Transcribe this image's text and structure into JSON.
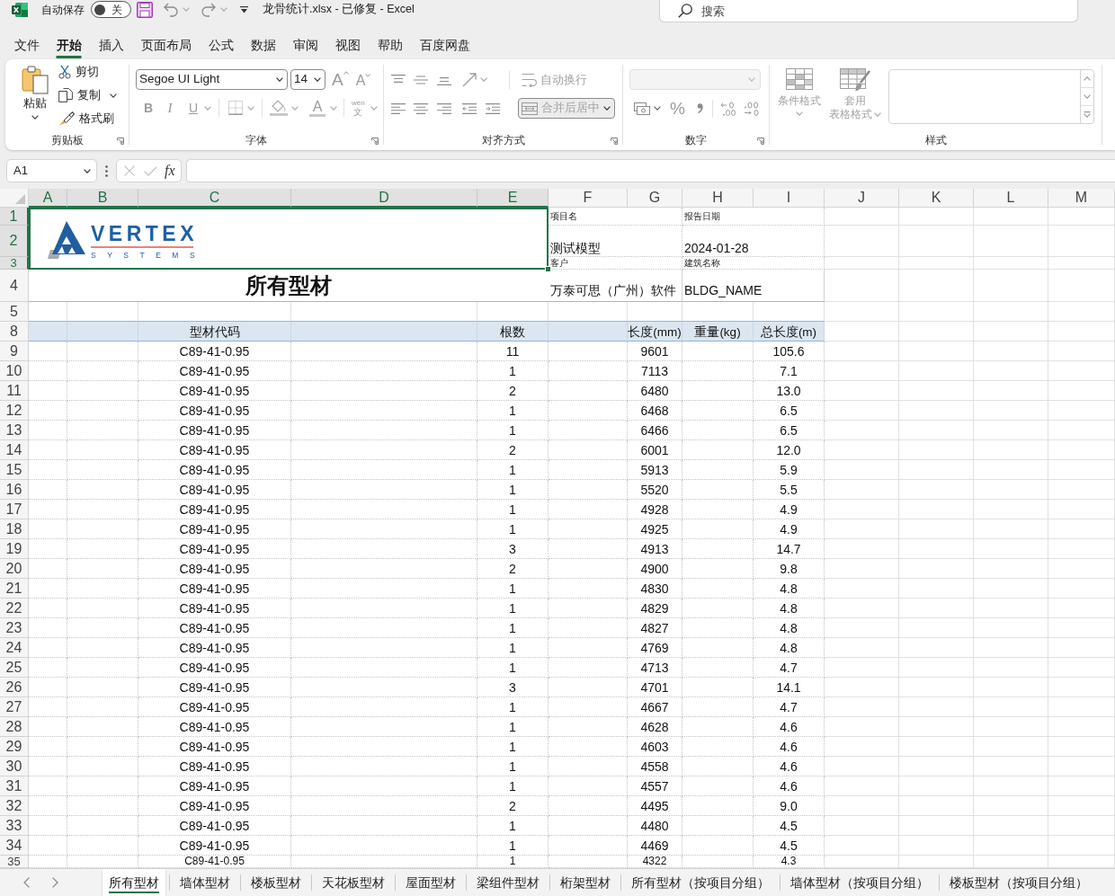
{
  "title_bar": {
    "autosave_label": "自动保存",
    "autosave": {
      "on": false,
      "label": "关"
    },
    "title": "龙骨统计.xlsx - 已修复 - Excel",
    "search": {
      "placeholder": "搜索"
    }
  },
  "ribbon_tabs": [
    {
      "label": "文件",
      "selected": false
    },
    {
      "label": "开始",
      "selected": true
    },
    {
      "label": "插入",
      "selected": false
    },
    {
      "label": "页面布局",
      "selected": false
    },
    {
      "label": "公式",
      "selected": false
    },
    {
      "label": "数据",
      "selected": false
    },
    {
      "label": "审阅",
      "selected": false
    },
    {
      "label": "视图",
      "selected": false
    },
    {
      "label": "帮助",
      "selected": false
    },
    {
      "label": "百度网盘",
      "selected": false
    }
  ],
  "ribbon": {
    "clipboard": {
      "label": "剪贴板",
      "paste": "粘贴",
      "cut": "剪切",
      "copy": "复制",
      "format_painter": "格式刷"
    },
    "font": {
      "label": "字体",
      "font_name": "Segoe UI Light",
      "font_size": "14",
      "grow": "A",
      "shrink": "A",
      "bold": "B",
      "italic": "I",
      "underline": "U",
      "font_color": "A",
      "phonetic": {
        "top": "wén",
        "bottom": "文"
      }
    },
    "alignment": {
      "label": "对齐方式",
      "wrap_text": {
        "label": "自动换行",
        "disabled": true
      },
      "merge_center": {
        "label": "合并后居中",
        "disabled": true,
        "on": true
      }
    },
    "number": {
      "label": "数字",
      "percent": "%"
    },
    "styles": {
      "label": "样式",
      "conditional_format": {
        "label": "条件格式",
        "disabled": true
      },
      "format_as_table": {
        "lines": [
          "套用",
          "表格格式"
        ],
        "disabled": true
      }
    }
  },
  "formula_bar": {
    "name_box": "A1",
    "function_label": "fx"
  },
  "sheet": {
    "columns": [
      {
        "label": "A",
        "selected": true
      },
      {
        "label": "B",
        "selected": true
      },
      {
        "label": "C",
        "selected": true
      },
      {
        "label": "D",
        "selected": true
      },
      {
        "label": "E",
        "selected": true
      },
      {
        "label": "F",
        "selected": false
      },
      {
        "label": "G",
        "selected": false
      },
      {
        "label": "H",
        "selected": false
      },
      {
        "label": "I",
        "selected": false
      },
      {
        "label": "J",
        "selected": false
      },
      {
        "label": "K",
        "selected": false
      },
      {
        "label": "L",
        "selected": false
      },
      {
        "label": "M",
        "selected": false
      }
    ],
    "row_headers": [
      {
        "label": "1",
        "selected": true
      },
      {
        "label": "2",
        "selected": true
      },
      {
        "label": "3",
        "selected": true
      },
      {
        "label": "4",
        "selected": false
      },
      {
        "label": "5",
        "selected": false
      },
      {
        "label": "8",
        "selected": false
      },
      {
        "label": "9",
        "selected": false
      },
      {
        "label": "10",
        "selected": false
      },
      {
        "label": "11",
        "selected": false
      },
      {
        "label": "12",
        "selected": false
      },
      {
        "label": "13",
        "selected": false
      },
      {
        "label": "14",
        "selected": false
      },
      {
        "label": "15",
        "selected": false
      },
      {
        "label": "16",
        "selected": false
      },
      {
        "label": "17",
        "selected": false
      },
      {
        "label": "18",
        "selected": false
      },
      {
        "label": "19",
        "selected": false
      },
      {
        "label": "20",
        "selected": false
      },
      {
        "label": "21",
        "selected": false
      },
      {
        "label": "22",
        "selected": false
      },
      {
        "label": "23",
        "selected": false
      },
      {
        "label": "24",
        "selected": false
      },
      {
        "label": "25",
        "selected": false
      },
      {
        "label": "26",
        "selected": false
      },
      {
        "label": "27",
        "selected": false
      },
      {
        "label": "28",
        "selected": false
      },
      {
        "label": "29",
        "selected": false
      },
      {
        "label": "30",
        "selected": false
      },
      {
        "label": "31",
        "selected": false
      },
      {
        "label": "32",
        "selected": false
      },
      {
        "label": "33",
        "selected": false
      },
      {
        "label": "34",
        "selected": false
      },
      {
        "label": "35",
        "selected": false
      }
    ],
    "logo": {
      "name": "VERTEX",
      "tagline": "SYSTEMS",
      "selected": true
    },
    "info_rows": [
      {
        "kind": "label",
        "cells": [
          "项目名",
          "报告日期"
        ]
      },
      {
        "kind": "value",
        "cells": [
          "测试模型",
          "2024-01-28"
        ]
      },
      {
        "kind": "label",
        "cells": [
          "客户",
          "建筑名称"
        ]
      },
      {
        "kind": "value",
        "cells": [
          "万泰可思（广州）软件",
          "BLDG_NAME"
        ]
      }
    ],
    "title": "所有型材",
    "table": {
      "columns": [
        "型材代码",
        "根数",
        "长度(mm)",
        "重量(kg)",
        "总长度(m)"
      ],
      "rows": [
        {
          "code": "C89-41-0.95",
          "count": "11",
          "length": "9601",
          "total": "105.6"
        },
        {
          "code": "C89-41-0.95",
          "count": "1",
          "length": "7113",
          "total": "7.1"
        },
        {
          "code": "C89-41-0.95",
          "count": "2",
          "length": "6480",
          "total": "13.0"
        },
        {
          "code": "C89-41-0.95",
          "count": "1",
          "length": "6468",
          "total": "6.5"
        },
        {
          "code": "C89-41-0.95",
          "count": "1",
          "length": "6466",
          "total": "6.5"
        },
        {
          "code": "C89-41-0.95",
          "count": "2",
          "length": "6001",
          "total": "12.0"
        },
        {
          "code": "C89-41-0.95",
          "count": "1",
          "length": "5913",
          "total": "5.9"
        },
        {
          "code": "C89-41-0.95",
          "count": "1",
          "length": "5520",
          "total": "5.5"
        },
        {
          "code": "C89-41-0.95",
          "count": "1",
          "length": "4928",
          "total": "4.9"
        },
        {
          "code": "C89-41-0.95",
          "count": "1",
          "length": "4925",
          "total": "4.9"
        },
        {
          "code": "C89-41-0.95",
          "count": "3",
          "length": "4913",
          "total": "14.7"
        },
        {
          "code": "C89-41-0.95",
          "count": "2",
          "length": "4900",
          "total": "9.8"
        },
        {
          "code": "C89-41-0.95",
          "count": "1",
          "length": "4830",
          "total": "4.8"
        },
        {
          "code": "C89-41-0.95",
          "count": "1",
          "length": "4829",
          "total": "4.8"
        },
        {
          "code": "C89-41-0.95",
          "count": "1",
          "length": "4827",
          "total": "4.8"
        },
        {
          "code": "C89-41-0.95",
          "count": "1",
          "length": "4769",
          "total": "4.8"
        },
        {
          "code": "C89-41-0.95",
          "count": "1",
          "length": "4713",
          "total": "4.7"
        },
        {
          "code": "C89-41-0.95",
          "count": "3",
          "length": "4701",
          "total": "14.1"
        },
        {
          "code": "C89-41-0.95",
          "count": "1",
          "length": "4667",
          "total": "4.7"
        },
        {
          "code": "C89-41-0.95",
          "count": "1",
          "length": "4628",
          "total": "4.6"
        },
        {
          "code": "C89-41-0.95",
          "count": "1",
          "length": "4603",
          "total": "4.6"
        },
        {
          "code": "C89-41-0.95",
          "count": "1",
          "length": "4558",
          "total": "4.6"
        },
        {
          "code": "C89-41-0.95",
          "count": "1",
          "length": "4557",
          "total": "4.6"
        },
        {
          "code": "C89-41-0.95",
          "count": "2",
          "length": "4495",
          "total": "9.0"
        },
        {
          "code": "C89-41-0.95",
          "count": "1",
          "length": "4480",
          "total": "4.5"
        },
        {
          "code": "C89-41-0.95",
          "count": "1",
          "length": "4469",
          "total": "4.5"
        },
        {
          "code": "C89-41-0.95",
          "count": "1",
          "length": "4322",
          "total": "4.3"
        }
      ]
    }
  },
  "sheet_tabs": [
    {
      "label": "所有型材",
      "selected": true
    },
    {
      "label": "墙体型材",
      "selected": false
    },
    {
      "label": "楼板型材",
      "selected": false
    },
    {
      "label": "天花板型材",
      "selected": false
    },
    {
      "label": "屋面型材",
      "selected": false
    },
    {
      "label": "梁组件型材",
      "selected": false
    },
    {
      "label": "桁架型材",
      "selected": false
    },
    {
      "label": "所有型材（按项目分组）",
      "selected": false
    },
    {
      "label": "墙体型材（按项目分组）",
      "selected": false
    },
    {
      "label": "楼板型材（按项目分组）",
      "selected": false
    }
  ]
}
